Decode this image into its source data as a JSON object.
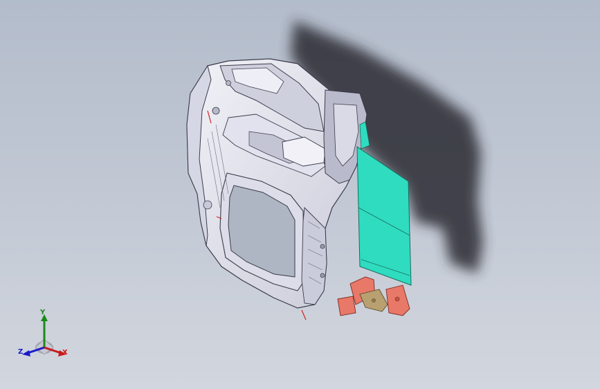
{
  "viewport": {
    "background_top": "#b3bccb",
    "background_bottom": "#d2d6de"
  },
  "model": {
    "body_color": "#e6e6ef",
    "edge_color": "#3a3a4a",
    "panel_color": "#2fdcc0",
    "bracket_color": "#e87868",
    "plate_color": "#b8a070",
    "shadow_color": "#2a2c30"
  },
  "triad": {
    "x_label": "X",
    "y_label": "Y",
    "z_label": "Z",
    "x_color": "#c81a1a",
    "y_color": "#1a8a1a",
    "z_color": "#1a1acc"
  }
}
